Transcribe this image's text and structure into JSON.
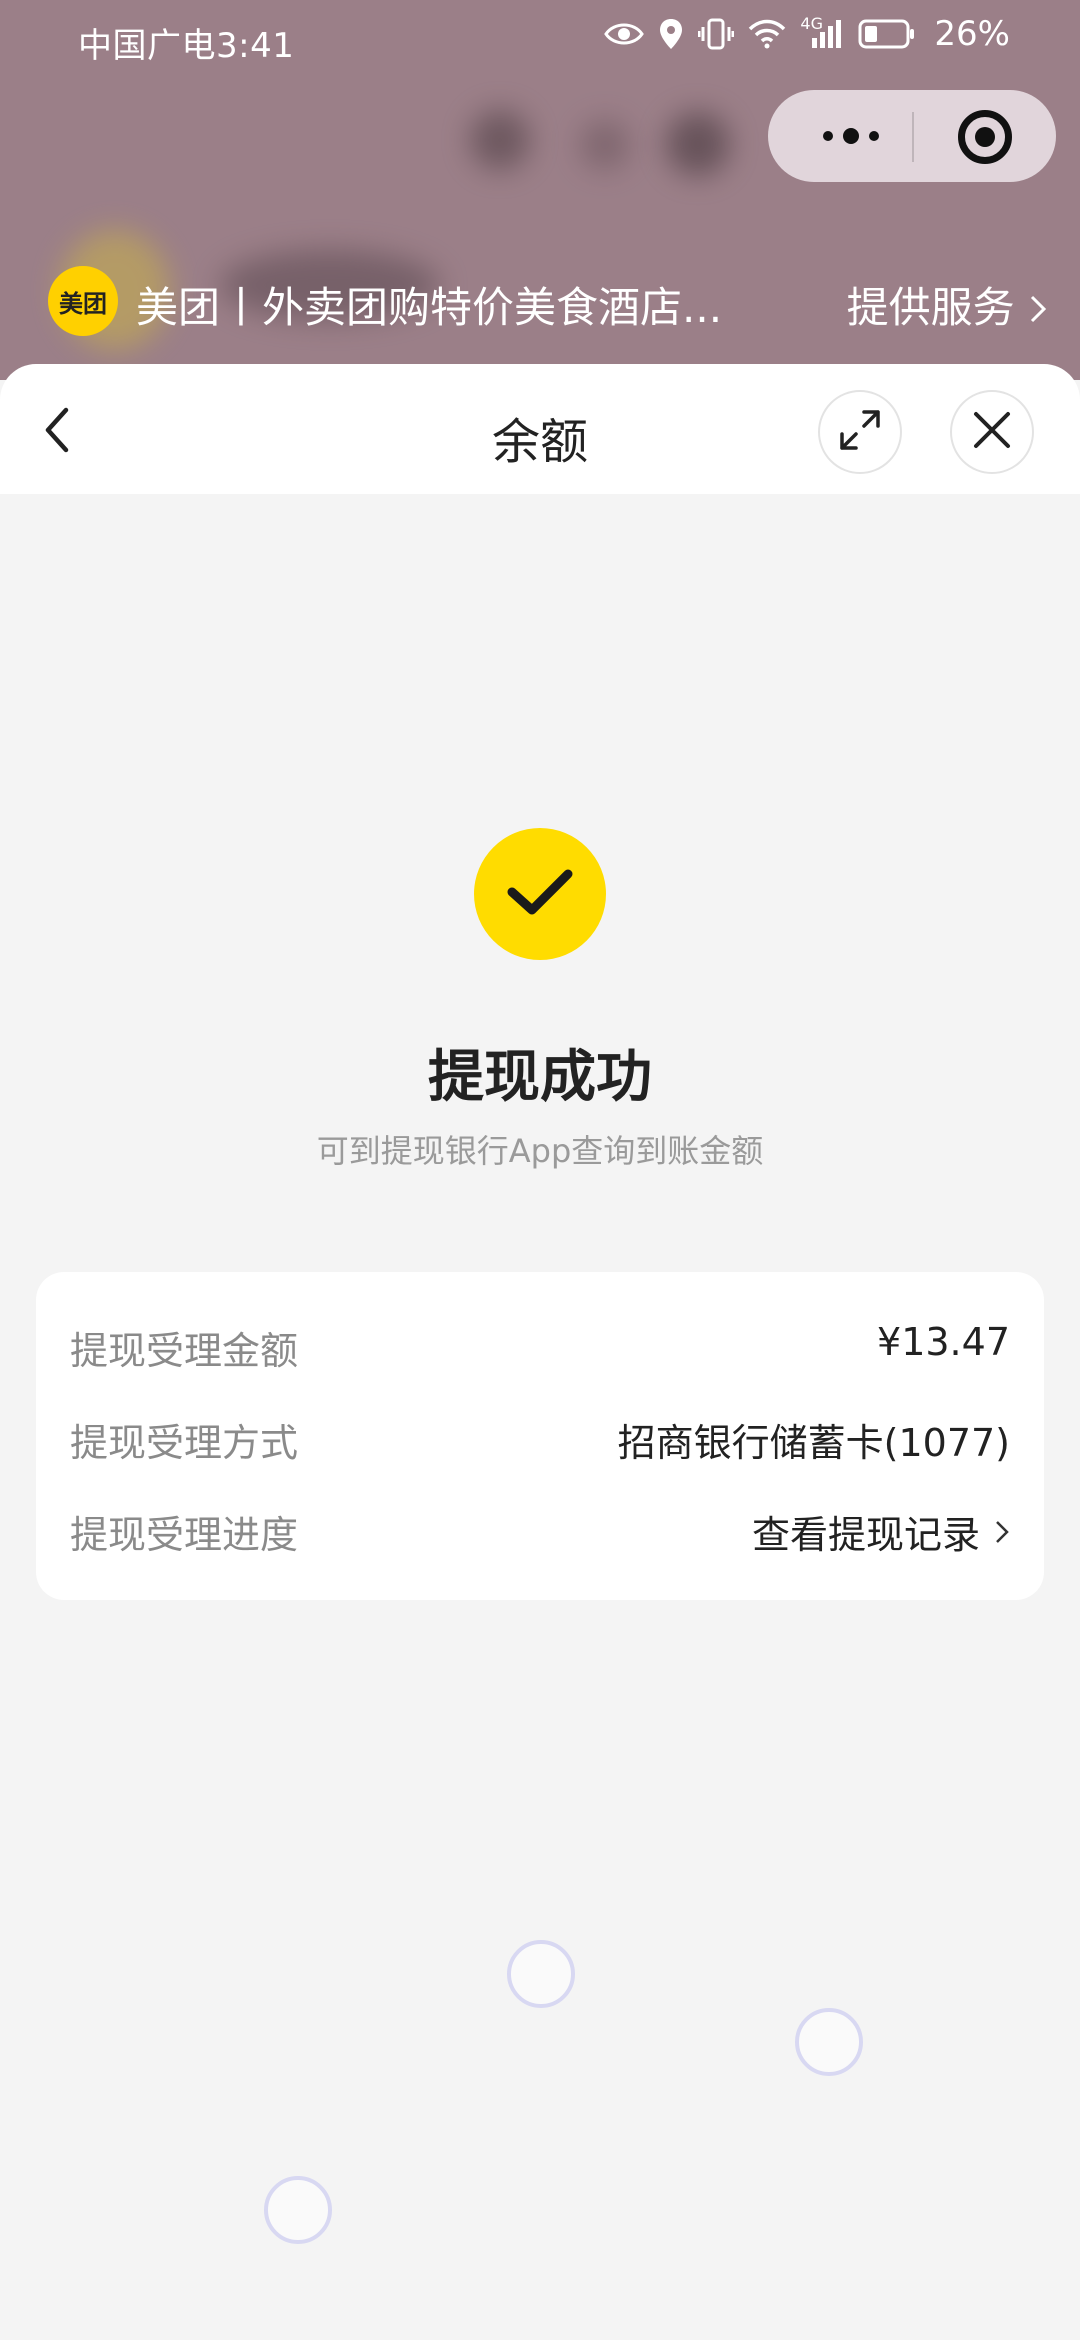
{
  "status_bar": {
    "carrier_time": "中国广电3:41",
    "network": "4G",
    "battery": "26%"
  },
  "mini_program": {
    "logo_text": "美团",
    "title": "美团丨外卖团购特价美食酒店...",
    "service_label": "提供服务"
  },
  "header": {
    "title": "余额"
  },
  "result": {
    "title": "提现成功",
    "subtitle": "可到提现银行App查询到账金额"
  },
  "details": {
    "rows": [
      {
        "label": "提现受理金额",
        "value": "¥13.47"
      },
      {
        "label": "提现受理方式",
        "value": "招商银行储蓄卡(1077)"
      },
      {
        "label": "提现受理进度",
        "value": "查看提现记录"
      }
    ]
  },
  "colors": {
    "accent": "#ffdc00",
    "top_background": "#9b7f88",
    "page_background": "#f4f4f4"
  },
  "icons": [
    "eye-icon",
    "location-icon",
    "vibrate-icon",
    "wifi-icon",
    "signal-icon",
    "battery-icon",
    "more-icon",
    "target-icon",
    "back-icon",
    "expand-icon",
    "close-icon",
    "check-icon",
    "chevron-right-icon"
  ]
}
